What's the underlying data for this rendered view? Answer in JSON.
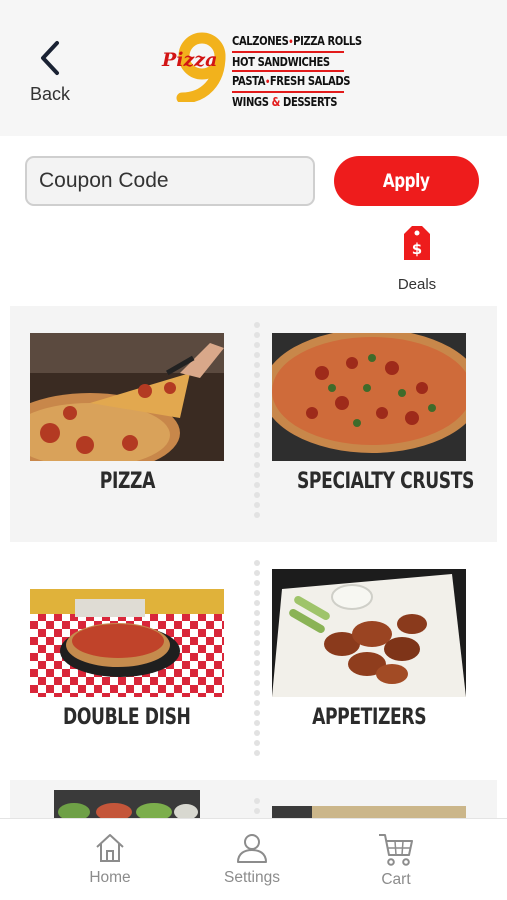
{
  "header": {
    "back_label": "Back",
    "logo": {
      "lines": [
        {
          "parts": [
            "CALZONES",
            "•",
            "PIZZA ROLLS"
          ]
        },
        {
          "parts": [
            "HOT SANDWICHES"
          ]
        },
        {
          "parts": [
            "PASTA",
            "•",
            "FRESH SALADS"
          ]
        },
        {
          "parts": [
            "WINGS",
            "&",
            "DESSERTS"
          ]
        }
      ]
    }
  },
  "coupon": {
    "placeholder": "Coupon Code",
    "apply_label": "Apply"
  },
  "deals": {
    "label": "Deals",
    "icon": "price-tag-icon"
  },
  "categories": [
    {
      "label": "PIZZA"
    },
    {
      "label": "SPECIALTY CRUSTS"
    },
    {
      "label": "DOUBLE DISH"
    },
    {
      "label": "APPETIZERS"
    }
  ],
  "bottom_nav": [
    {
      "label": "Home",
      "icon": "home-icon"
    },
    {
      "label": "Settings",
      "icon": "user-icon"
    },
    {
      "label": "Cart",
      "icon": "cart-icon"
    }
  ],
  "colors": {
    "accent": "#ee1c1c",
    "header_bg": "#f6f6f6",
    "band_bg": "#f4f4f4",
    "nav_text": "#8c8c8c"
  }
}
